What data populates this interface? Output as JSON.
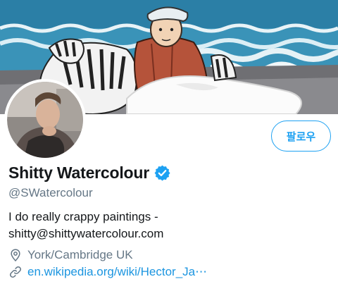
{
  "profile": {
    "display_name": "Shitty Watercolour",
    "handle": "@SWatercolour",
    "verified": true,
    "bio_line1": "I do really crappy paintings -",
    "bio_line2": "shitty@shittywatercolour.com",
    "location": "York/Cambridge UK",
    "website": "en.wikipedia.org/wiki/Hector_Ja⋯"
  },
  "actions": {
    "follow_label": "팔로우"
  },
  "icons": {
    "verified": "verified-badge-icon",
    "location": "location-pin-icon",
    "link": "link-icon"
  },
  "colors": {
    "accent": "#1da1f2",
    "link": "#1b95e0",
    "secondary_text": "#657786",
    "primary_text": "#14171a"
  }
}
